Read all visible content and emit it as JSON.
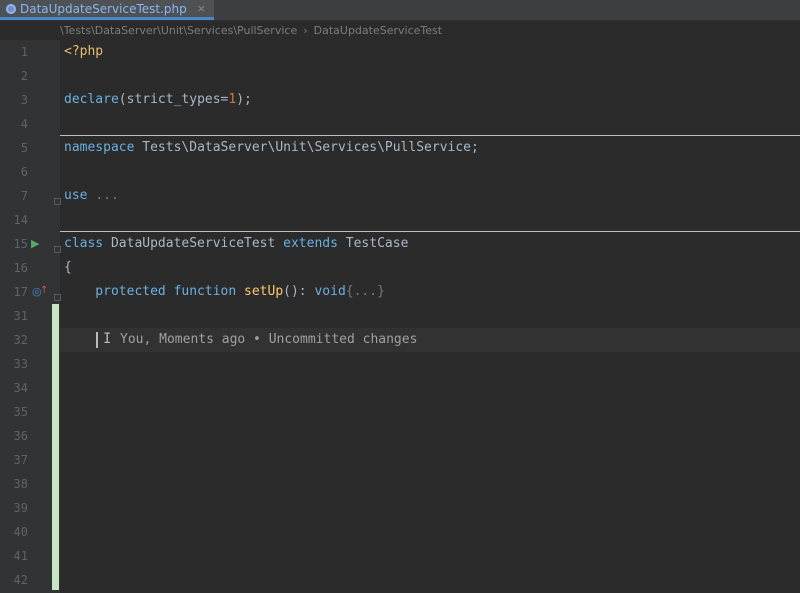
{
  "tab": {
    "label": "DataUpdateServiceTest.php",
    "close": "×"
  },
  "breadcrumb": {
    "path": "\\Tests\\DataServer\\Unit\\Services\\PullService",
    "separator": "›",
    "class_name": "DataUpdateServiceTest"
  },
  "lines": [
    {
      "num": "1",
      "segments": [
        {
          "t": "<?php",
          "c": "ph"
        }
      ]
    },
    {
      "num": "2",
      "segments": []
    },
    {
      "num": "3",
      "segments": [
        {
          "t": "declare",
          "c": "kw"
        },
        {
          "t": "(strict_types=",
          "c": ""
        },
        {
          "t": "1",
          "c": "num"
        },
        {
          "t": ");",
          "c": ""
        }
      ]
    },
    {
      "num": "4",
      "segments": []
    },
    {
      "num": "5",
      "segments": [
        {
          "t": "namespace ",
          "c": "kw"
        },
        {
          "t": "Tests\\DataServer\\Unit\\Services\\PullService;",
          "c": ""
        }
      ]
    },
    {
      "num": "6",
      "segments": []
    },
    {
      "num": "7",
      "segments": [
        {
          "t": "use ",
          "c": "kw"
        },
        {
          "t": "...",
          "c": "fold"
        }
      ]
    },
    {
      "num": "14",
      "segments": []
    },
    {
      "num": "15",
      "segments": [
        {
          "t": "class ",
          "c": "kw"
        },
        {
          "t": "DataUpdateServiceTest ",
          "c": ""
        },
        {
          "t": "extends ",
          "c": "kw"
        },
        {
          "t": "TestCase",
          "c": ""
        }
      ]
    },
    {
      "num": "16",
      "segments": [
        {
          "t": "{",
          "c": ""
        }
      ]
    },
    {
      "num": "17",
      "segments": [
        {
          "t": "    protected function ",
          "c": "kw"
        },
        {
          "t": "setUp",
          "c": "fn"
        },
        {
          "t": "(): ",
          "c": ""
        },
        {
          "t": "void",
          "c": "kw"
        },
        {
          "t": "{...}",
          "c": "fold"
        }
      ]
    },
    {
      "num": "31",
      "segments": []
    },
    {
      "num": "32",
      "segments": []
    },
    {
      "num": "33",
      "segments": []
    },
    {
      "num": "34",
      "segments": []
    },
    {
      "num": "35",
      "segments": []
    },
    {
      "num": "36",
      "segments": []
    },
    {
      "num": "37",
      "segments": []
    },
    {
      "num": "38",
      "segments": []
    },
    {
      "num": "39",
      "segments": []
    },
    {
      "num": "40",
      "segments": []
    },
    {
      "num": "41",
      "segments": []
    },
    {
      "num": "42",
      "segments": []
    }
  ],
  "blame": "You, Moments ago • Uncommitted changes",
  "ibeam": "I",
  "icons": {
    "run": "run-test-icon",
    "override": "override-method-icon"
  },
  "colors": {
    "keyword": "#6ab0e0",
    "php_tag": "#e8bf6a",
    "number": "#cc7832",
    "function": "#ffc66d",
    "vcs_added": "#c7e6c3"
  }
}
